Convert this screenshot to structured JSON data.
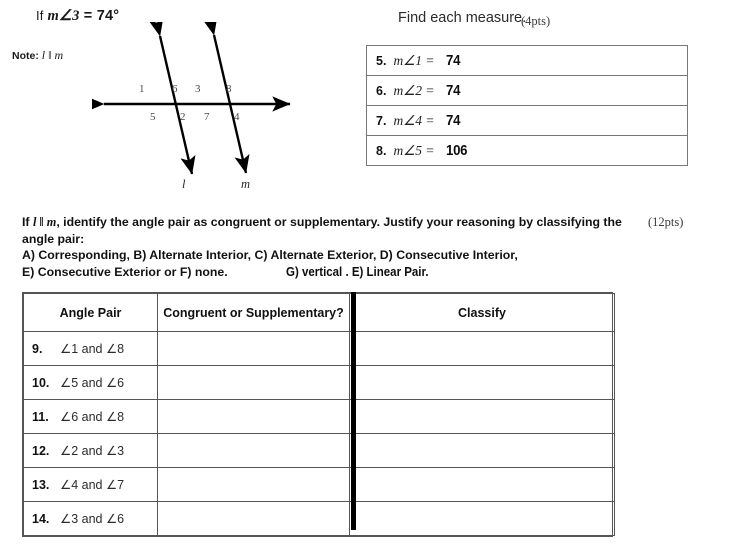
{
  "header": {
    "condition_lead": "If ",
    "condition_var": "m∠3",
    "condition_rest": " = 74°",
    "note_label": "Note: ",
    "note_value": "l ‖ m"
  },
  "diagram": {
    "angle_labels_top": [
      "1",
      "6",
      "3",
      "8"
    ],
    "angle_labels_bottom": [
      "5",
      "2",
      "7",
      "4"
    ],
    "line_label_left": "l",
    "line_label_right": "m"
  },
  "find_measure": {
    "heading": "Find each measure.",
    "points": "(4pts)",
    "rows": [
      {
        "number": "5.",
        "expression": "m∠1 =",
        "answer": "74"
      },
      {
        "number": "6.",
        "expression": "m∠2 =",
        "answer": "74"
      },
      {
        "number": "7.",
        "expression": "m∠4 =",
        "answer": "74"
      },
      {
        "number": "8.",
        "expression": "m∠5 =",
        "answer": "106"
      }
    ]
  },
  "instructions": {
    "line1_pre": "If ",
    "line1_var": "l ‖ m",
    "line1_post": ", identify the angle pair as congruent or supplementary. Justify your reasoning by classifying the angle pair:",
    "line2": "A) Corresponding, B) Alternate Interior, C) Alternate Exterior, D) Consecutive Interior,",
    "line3": "E) Consecutive Exterior or F) none.",
    "points": "(12pts)",
    "handwritten_addition": "G) vertical . E) Linear Pair."
  },
  "classify_table": {
    "headers": [
      "Angle Pair",
      "Congruent or Supplementary?",
      "Classify"
    ],
    "rows": [
      {
        "number": "9.",
        "pair": "∠1 and ∠8",
        "congruent_or_supplementary": "",
        "classify": ""
      },
      {
        "number": "10.",
        "pair": "∠5 and ∠6",
        "congruent_or_supplementary": "",
        "classify": ""
      },
      {
        "number": "11.",
        "pair": "∠6 and ∠8",
        "congruent_or_supplementary": "",
        "classify": ""
      },
      {
        "number": "12.",
        "pair": "∠2 and ∠3",
        "congruent_or_supplementary": "",
        "classify": ""
      },
      {
        "number": "13.",
        "pair": "∠4 and ∠7",
        "congruent_or_supplementary": "",
        "classify": ""
      },
      {
        "number": "14.",
        "pair": "∠3 and ∠6",
        "congruent_or_supplementary": "",
        "classify": ""
      }
    ]
  }
}
